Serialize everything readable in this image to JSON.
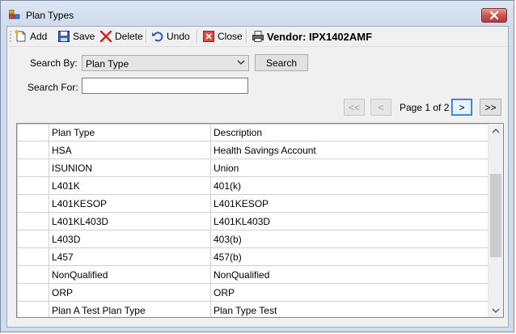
{
  "window": {
    "title": "Plan Types"
  },
  "toolbar": {
    "add_label": "Add",
    "save_label": "Save",
    "delete_label": "Delete",
    "undo_label": "Undo",
    "close_label": "Close",
    "vendor_label": "Vendor: IPX1402AMF"
  },
  "search": {
    "search_by_label": "Search By:",
    "search_by_value": "Plan Type",
    "search_button": "Search",
    "search_for_label": "Search For:",
    "search_for_value": ""
  },
  "pager": {
    "first_label": "<<",
    "prev_label": "<",
    "page_text": "Page 1 of 2",
    "next_label": ">",
    "last_label": ">>"
  },
  "grid": {
    "columns": [
      "Plan Type",
      "Description"
    ],
    "rows": [
      {
        "plan_type": "HSA",
        "description": "Health Savings Account"
      },
      {
        "plan_type": "ISUNION",
        "description": "Union"
      },
      {
        "plan_type": "L401K",
        "description": "401(k)"
      },
      {
        "plan_type": "L401KESOP",
        "description": "L401KESOP"
      },
      {
        "plan_type": "L401KL403D",
        "description": "L401KL403D"
      },
      {
        "plan_type": "L403D",
        "description": "403(b)"
      },
      {
        "plan_type": "L457",
        "description": "457(b)"
      },
      {
        "plan_type": "NonQualified",
        "description": "NonQualified"
      },
      {
        "plan_type": "ORP",
        "description": "ORP"
      },
      {
        "plan_type": "Plan A Test Plan Type",
        "description": "Plan Type Test"
      }
    ]
  }
}
